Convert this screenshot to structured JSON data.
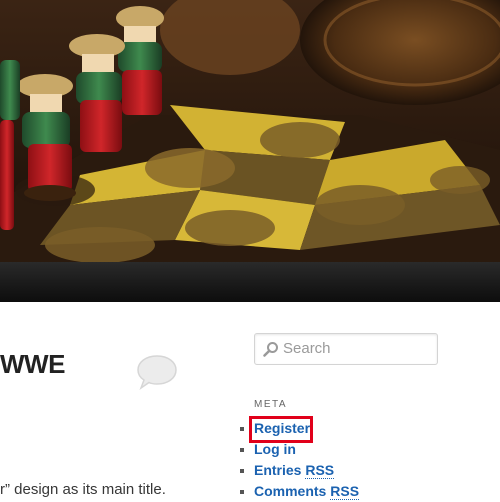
{
  "post": {
    "title": "WWE",
    "excerpt": "r” design as its main title."
  },
  "search": {
    "placeholder": "Search"
  },
  "meta_widget": {
    "title": "META",
    "links": [
      {
        "label": "Register"
      },
      {
        "label": "Log in"
      },
      {
        "label_main": "Entries",
        "label_abbr": "RSS"
      },
      {
        "label_main": "Comments",
        "label_abbr": "RSS"
      }
    ],
    "highlighted_link": "Register",
    "highlight_color": "#e1001a"
  },
  "colors": {
    "link": "#1b62b0",
    "navbar": "#1a1a1a"
  },
  "icons": {
    "search": "search-icon",
    "comment": "comment-bubble-icon"
  }
}
